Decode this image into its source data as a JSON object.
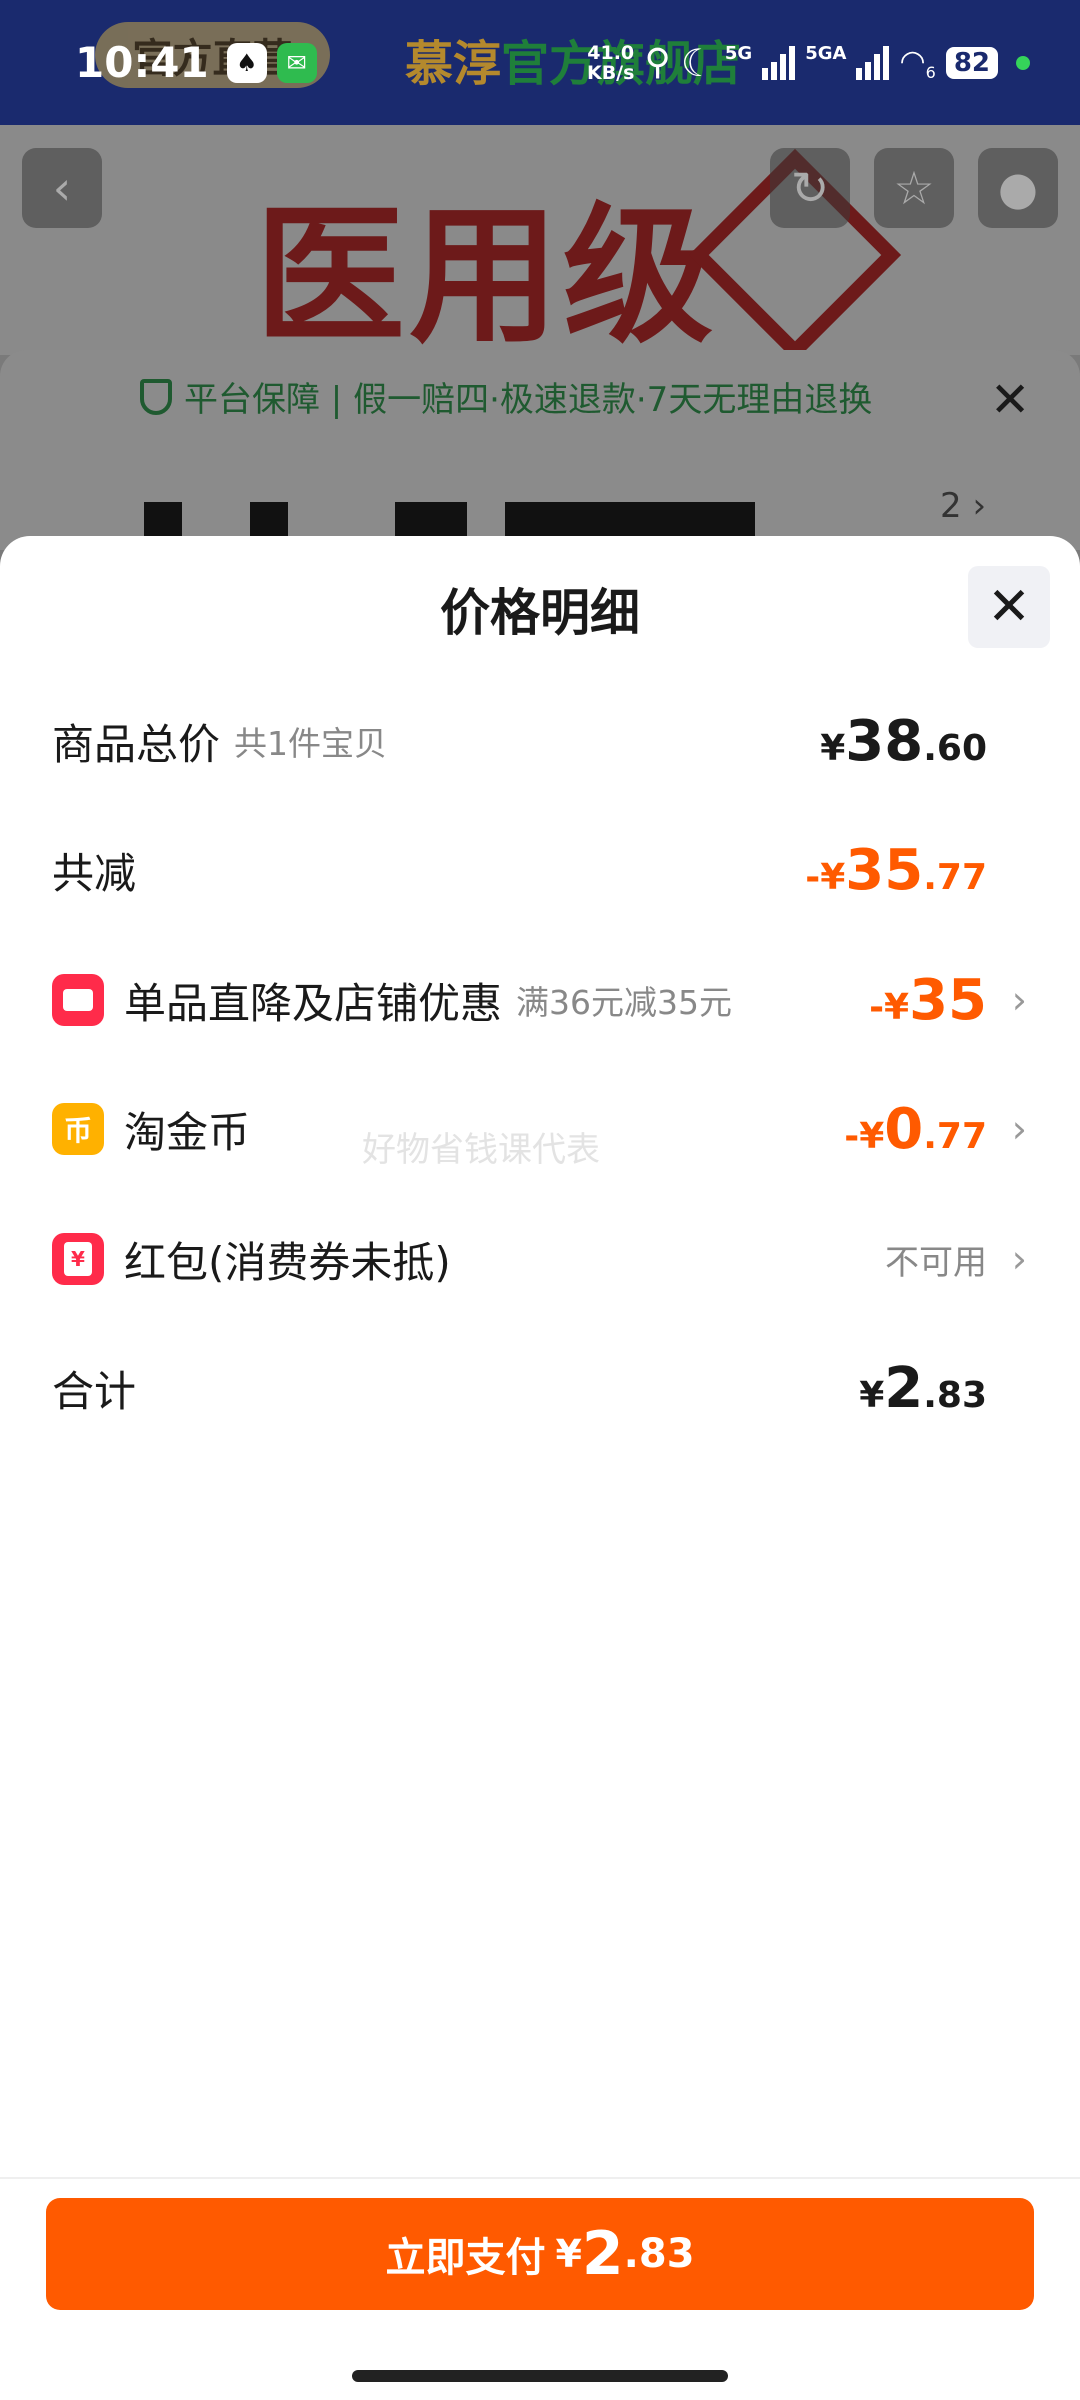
{
  "status_bar": {
    "time": "10:41",
    "speed": "41.0",
    "speed_unit": "KB/s",
    "net1": "5G",
    "net2": "5GA",
    "wifi_sub": "6",
    "battery": "82"
  },
  "background": {
    "store_badge": "官方直营",
    "store_name_a": "慕淳",
    "store_name_b": "官方旗舰店",
    "banner_text": "医用级",
    "guarantee": "平台保障 | 假一赔四·极速退款·7天无理由退换",
    "page_num": "2"
  },
  "sheet": {
    "title": "价格明细",
    "total": {
      "label": "商品总价",
      "sub": "共1件宝贝",
      "yen": "¥",
      "int": "38",
      "dec": ".60"
    },
    "reduced": {
      "label": "共减",
      "yen": "-¥",
      "int": "35",
      "dec": ".77"
    },
    "discounts": [
      {
        "label": "单品直降及店铺优惠",
        "sub": "满36元减35元",
        "yen": "-¥",
        "int": "35",
        "dec": ""
      },
      {
        "label": "淘金币",
        "yen": "-¥",
        "int": "0",
        "dec": ".77"
      },
      {
        "label": "红包(消费券未抵)",
        "status": "不可用"
      }
    ],
    "sum": {
      "label": "合计",
      "yen": "¥",
      "int": "2",
      "dec": ".83"
    },
    "watermark": "好物省钱课代表"
  },
  "footer": {
    "pay_label": "立即支付",
    "yen": "¥",
    "int": "2",
    "dec": ".83"
  },
  "colors": {
    "accent_orange": "#ff5a00",
    "shop_icon_red": "#ff2b4a",
    "coin_yellow": "#ffb100"
  }
}
